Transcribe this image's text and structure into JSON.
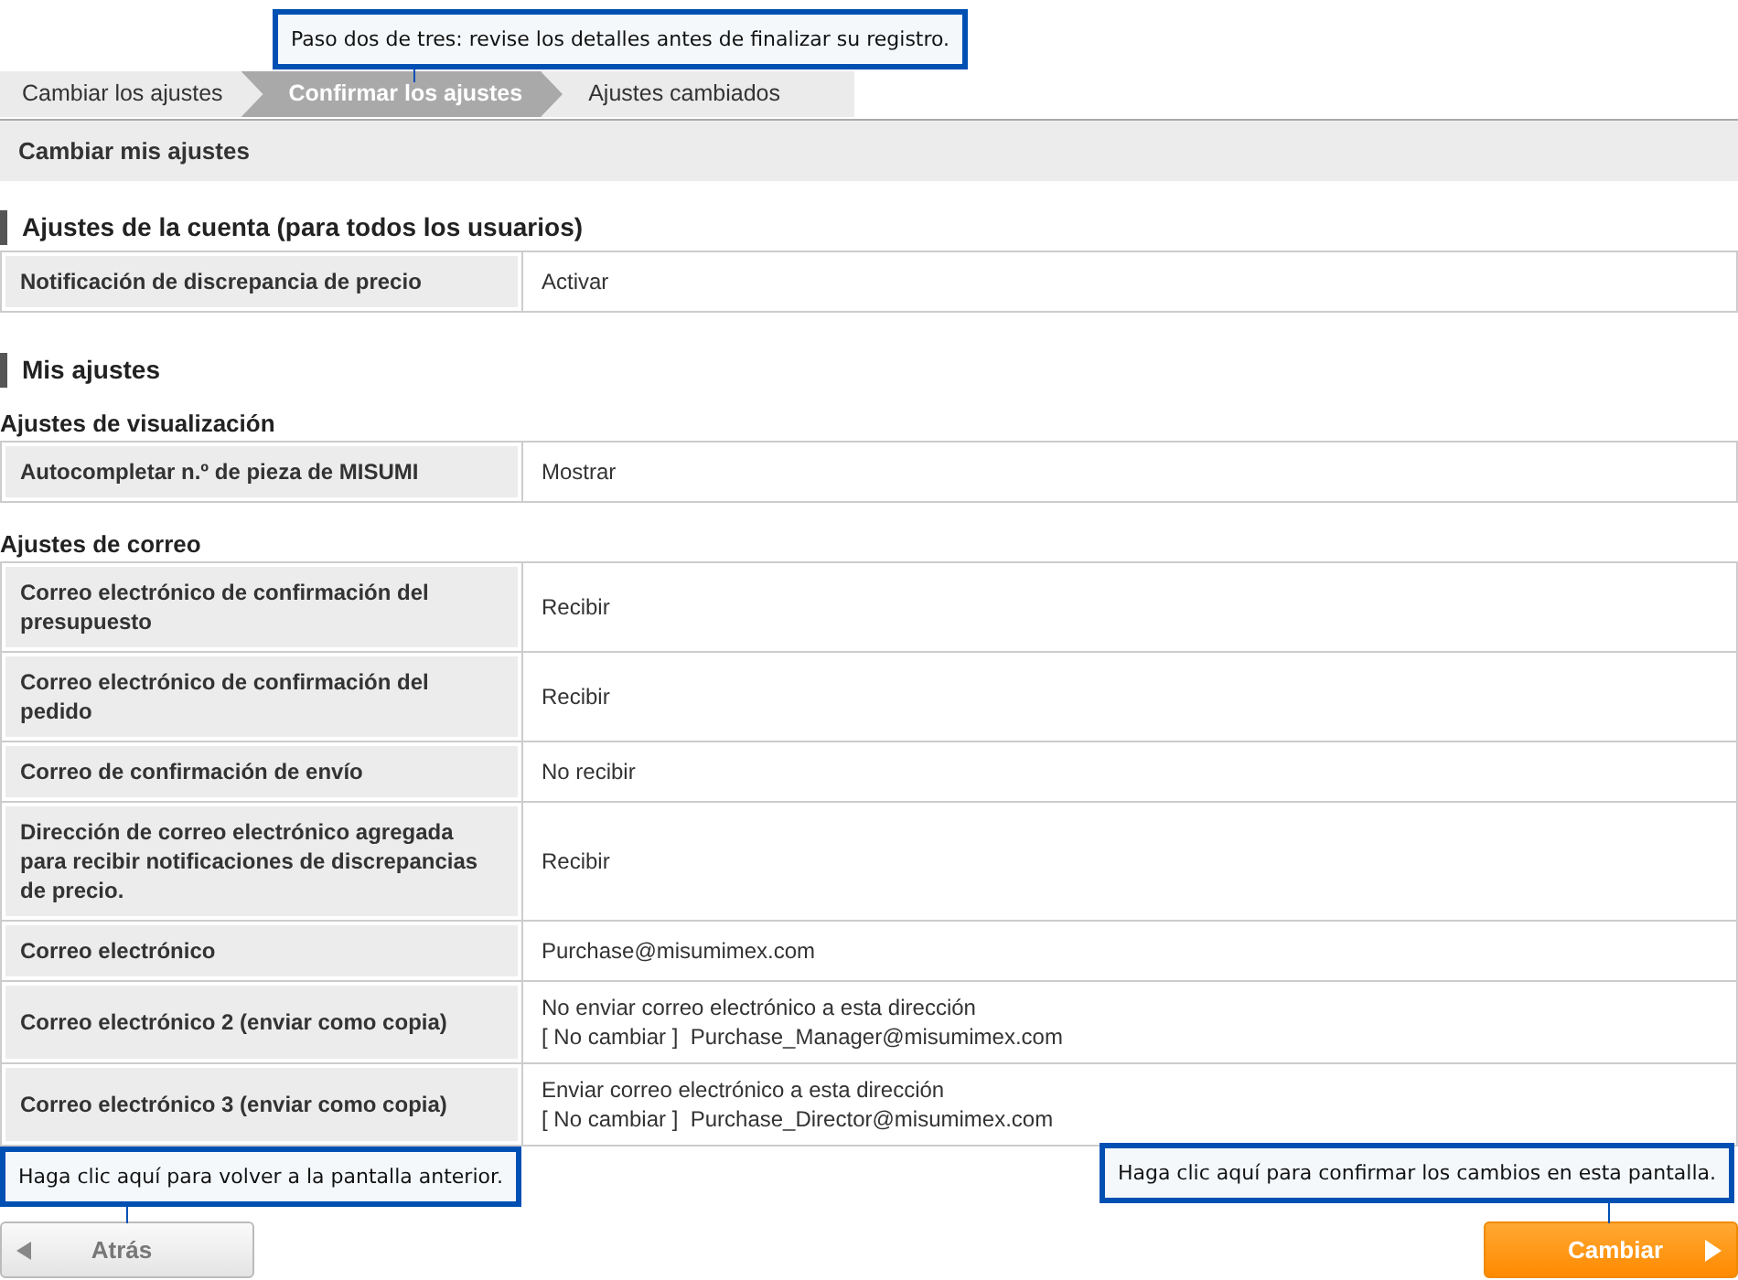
{
  "steps": [
    {
      "label": "Cambiar los ajustes",
      "selected": false
    },
    {
      "label": "Confirmar los ajustes",
      "selected": true
    },
    {
      "label": "Ajustes cambiados",
      "selected": false
    }
  ],
  "page_title": "Cambiar mis ajustes",
  "sections": [
    {
      "kind": "heading",
      "text": "Ajustes de la cuenta (para todos los usuarios)"
    },
    {
      "kind": "table",
      "rows": [
        {
          "label": "Notificación de discrepancia de precio",
          "values": [
            "Activar"
          ]
        }
      ]
    },
    {
      "kind": "heading",
      "text": "Mis ajustes"
    },
    {
      "kind": "subheading",
      "text": "Ajustes de visualización"
    },
    {
      "kind": "table",
      "rows": [
        {
          "label": "Autocompletar n.º de pieza de MISUMI",
          "values": [
            "Mostrar"
          ]
        }
      ]
    },
    {
      "kind": "subheading",
      "text": "Ajustes de correo"
    },
    {
      "kind": "table",
      "rows": [
        {
          "label": "Correo electrónico de confirmación del presupuesto",
          "values": [
            "Recibir"
          ]
        },
        {
          "label": "Correo electrónico de confirmación del pedido",
          "values": [
            "Recibir"
          ]
        },
        {
          "label": "Correo de confirmación de envío",
          "values": [
            "No recibir"
          ]
        },
        {
          "label": "Dirección de correo electrónico agregada para recibir notificaciones de discrepancias de precio.",
          "values": [
            "Recibir"
          ]
        },
        {
          "label": "Correo electrónico",
          "values": [
            "Purchase@misumimex.com"
          ]
        },
        {
          "label": "Correo electrónico 2 (enviar como copia)",
          "values": [
            "No enviar correo electrónico a esta dirección",
            "[ No cambiar ]  Purchase_Manager@misumimex.com"
          ]
        },
        {
          "label": "Correo electrónico 3 (enviar como copia)",
          "values": [
            "Enviar correo electrónico a esta dirección",
            "[ No cambiar ]  Purchase_Director@misumimex.com"
          ]
        }
      ]
    }
  ],
  "callouts": [
    {
      "kind": "top",
      "text": "Paso dos de tres: revise los detalles antes de finalizar su registro."
    },
    {
      "kind": "left",
      "text": "Haga clic aquí para volver a la pantalla anterior."
    },
    {
      "kind": "right",
      "text": "Haga clic aquí para confirmar los cambios en esta pantalla."
    }
  ],
  "back_button": "Atrás",
  "submit_button": "Cambiar"
}
